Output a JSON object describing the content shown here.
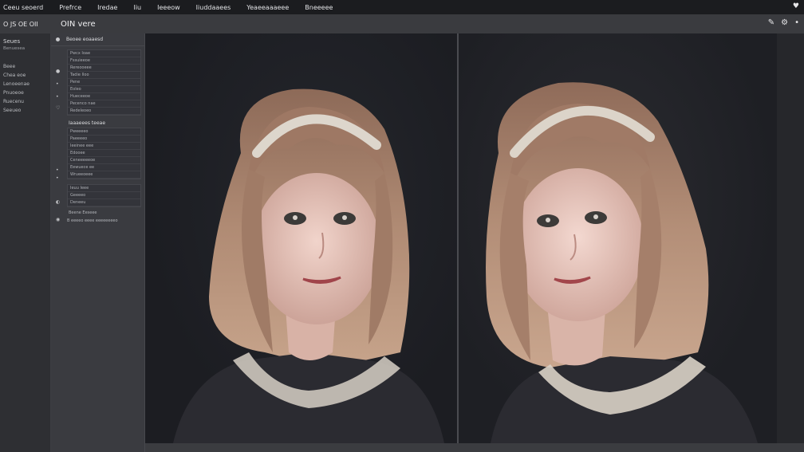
{
  "menubar": {
    "items": [
      "Ceeu seoerd",
      "Prefrce",
      "Iredae",
      "Iiu",
      "Ieeeow",
      "Iiuddaaees",
      "Yeaeeaaaeee",
      "Bneeeee"
    ],
    "heart_icon": "heart-icon"
  },
  "toolbar": {
    "left_label": "O  JS  OE  OII",
    "title": "OIN  vere",
    "icons": [
      "brush-icon",
      "settings-icon",
      "more-icon"
    ]
  },
  "sidebar": {
    "title": "Seues",
    "subtitle": "Benuesea",
    "items": [
      "Beee",
      "Chea eoe",
      "Lenoeenae",
      "Pnuoeoe",
      "Ruecenu",
      "Seeueo"
    ]
  },
  "panel": {
    "header": "Beoee eoaaesd",
    "group1": [
      "Pwcx Ioae",
      "Fssuieeoe",
      "Rereooeee",
      "Tadie Iloo",
      "Pene",
      "Eoleo",
      "Hueceeoe",
      "Pecenco nae",
      "Redeleoeo"
    ],
    "section_title": "Iaaaeees teeae",
    "group2": [
      "Pweeeeo",
      "Paeeeeo",
      "Ieeinee eee",
      "Edooee",
      "Ceneeeeeoe",
      "Eewuece ee",
      "Wrueeoeee"
    ],
    "group3": [
      "Ieuu Ieee",
      "Geeeeo",
      "Deneeu"
    ],
    "footer_label": "Beene  Eeseee",
    "footer_line": "B  eeeeo  eeee  eeeeeeeeo"
  },
  "viewers": {
    "left": {
      "label": "portrait-left"
    },
    "right": {
      "label": "portrait-right"
    }
  },
  "colors": {
    "hair": "#a47e6a",
    "hair_shadow": "#5e4234",
    "skin": "#e9c6bd",
    "sweater": "#2b2b31",
    "lace": "#d7d0c6"
  }
}
